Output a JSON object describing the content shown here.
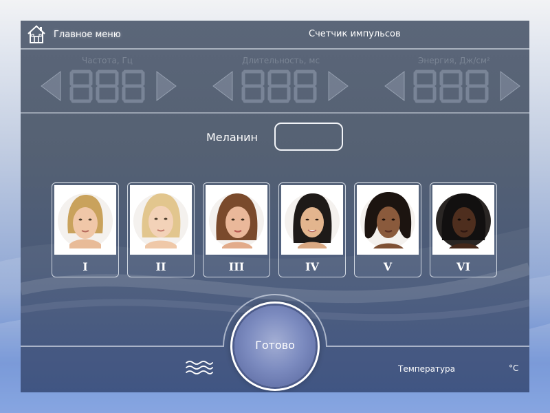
{
  "header": {
    "home_label": "Главное меню",
    "counter_label": "Счетчик импульсов"
  },
  "params": [
    {
      "label": "Частота, Гц",
      "value": "888"
    },
    {
      "label": "Длительность, мс",
      "value": "888"
    },
    {
      "label": "Энергия, Дж/см²",
      "value": "888"
    }
  ],
  "melanin": {
    "label": "Меланин",
    "value": ""
  },
  "skin_types": [
    {
      "label": "I"
    },
    {
      "label": "II"
    },
    {
      "label": "III"
    },
    {
      "label": "IV"
    },
    {
      "label": "V"
    },
    {
      "label": "VI"
    }
  ],
  "footer": {
    "ready_label": "Готово",
    "temperature_label": "Температура",
    "temperature_unit": "°С"
  },
  "icons": {
    "home": "home-icon",
    "arrow_left": "triangle-left-icon",
    "arrow_right": "triangle-right-icon",
    "cooling": "waves-icon"
  },
  "colors": {
    "panel": "#556173",
    "panel_bottom": "#364c7d",
    "inactive_text": "#7a8494",
    "button": "#7d8cc0"
  }
}
